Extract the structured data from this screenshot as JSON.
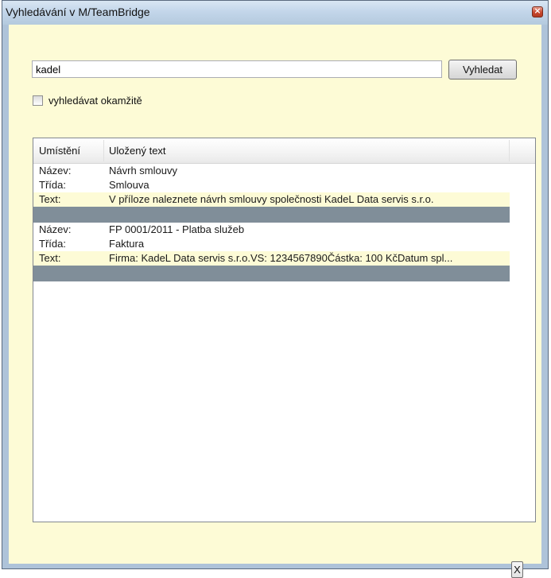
{
  "window": {
    "title": "Vyhledávání v M/TeamBridge",
    "close_glyph": "×"
  },
  "search": {
    "value": "kadel",
    "button_label": "Vyhledat"
  },
  "instant": {
    "label": "vyhledávat okamžitě",
    "checked": false
  },
  "table": {
    "columns": [
      "Umístění",
      "Uložený text"
    ],
    "groups": [
      {
        "rows": [
          {
            "label": "Název:",
            "value": "Návrh smlouvy"
          },
          {
            "label": "Třída:",
            "value": "Smlouva"
          },
          {
            "label": "Text:",
            "value": "V příloze naleznete návrh smlouvy společnosti KadeL Data servis s.r.o."
          }
        ]
      },
      {
        "rows": [
          {
            "label": "Název:",
            "value": "FP 0001/2011 - Platba služeb"
          },
          {
            "label": "Třída:",
            "value": "Faktura"
          },
          {
            "label": "Text:",
            "value": "Firma: KadeL Data servis s.r.o.VS: 1234567890Částka: 100 KčDatum spl..."
          }
        ]
      }
    ]
  },
  "footer": {
    "close_label": "X"
  },
  "colors": {
    "client_bg": "#fdfbd6",
    "separator": "#808e99",
    "frame": "#aec3d9"
  },
  "icons": {
    "title_close": "close-icon",
    "checkbox": "checkbox-icon"
  }
}
